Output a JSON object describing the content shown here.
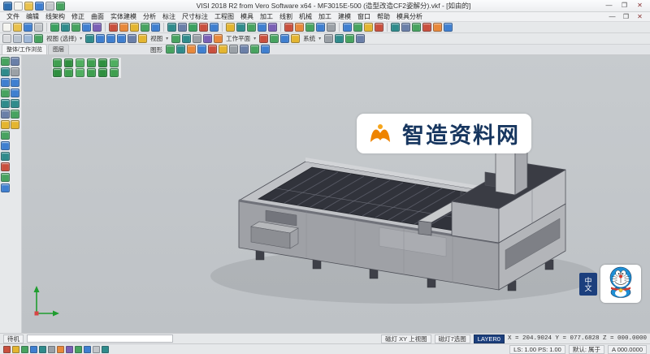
{
  "window": {
    "title": "VISI 2018 R2 from Vero Software x64  -  MF3015E-500 (造型改造CF2姿解分).vkf - [如由的]",
    "minimize": "—",
    "maximize": "❐",
    "close": "✕"
  },
  "qat": [
    {
      "n": "app-logo-icon",
      "c": "#2f6fb0"
    },
    {
      "n": "new-file-icon",
      "c": "#f4f4ef"
    },
    {
      "n": "open-folder-icon",
      "c": "#e9c14d"
    },
    {
      "n": "save-icon",
      "c": "#3f7fd0"
    },
    {
      "n": "print-icon",
      "c": "#c2c6ca"
    },
    {
      "n": "undo-icon",
      "c": "#47a35f"
    }
  ],
  "menu": {
    "items": [
      "文件",
      "编辑",
      "线架构",
      "修正",
      "曲面",
      "实体建模",
      "分析",
      "标注",
      "尺寸标注",
      "工程图",
      "模具",
      "加工",
      "线割",
      "机械",
      "加工",
      "建模",
      "窗口",
      "帮助",
      "模具分析"
    ]
  },
  "toolbars": {
    "row1": [
      {
        "n": "new-file-icon",
        "c": "#f4f4ef"
      },
      {
        "n": "open-folder-icon",
        "c": "#e9c14d"
      },
      {
        "n": "save-icon",
        "c": "#3f7fd0"
      },
      {
        "n": "print-icon",
        "c": "#c2c6ca"
      },
      "|",
      {
        "n": "point-tool-icon",
        "c": "#3aa15f"
      },
      {
        "n": "line-tool-icon",
        "c": "#2f8b8b"
      },
      {
        "n": "arc-tool-icon",
        "c": "#47a35f"
      },
      {
        "n": "circle-tool-icon",
        "c": "#3f7fd0"
      },
      {
        "n": "curve-tool-icon",
        "c": "#7a5fb5"
      },
      "|",
      {
        "n": "trim-tool-icon",
        "c": "#c94f3d"
      },
      {
        "n": "extend-tool-icon",
        "c": "#e8883a"
      },
      {
        "n": "fillet-tool-icon",
        "c": "#e4b52f"
      },
      {
        "n": "chamfer-tool-icon",
        "c": "#47a35f"
      },
      {
        "n": "offset-tool-icon",
        "c": "#3f7fd0"
      },
      "|",
      {
        "n": "surface-tool-icon",
        "c": "#2f8b8b"
      },
      {
        "n": "loft-tool-icon",
        "c": "#6a7fa8"
      },
      {
        "n": "sweep-tool-icon",
        "c": "#3aa15f"
      },
      {
        "n": "revolve-tool-icon",
        "c": "#c94f3d"
      },
      {
        "n": "extrude-tool-icon",
        "c": "#3f7fd0"
      },
      "|",
      {
        "n": "solid-box-icon",
        "c": "#e4b52f"
      },
      {
        "n": "solid-cylinder-icon",
        "c": "#2f8b8b"
      },
      {
        "n": "boolean-union-icon",
        "c": "#47a35f"
      },
      {
        "n": "boolean-subtract-icon",
        "c": "#3f7fd0"
      },
      {
        "n": "shell-tool-icon",
        "c": "#7a5fb5"
      },
      "|",
      {
        "n": "measure-icon",
        "c": "#c94f3d"
      },
      {
        "n": "dimension-icon",
        "c": "#e8883a"
      },
      {
        "n": "annotate-icon",
        "c": "#47a35f"
      },
      {
        "n": "layer-manager-icon",
        "c": "#3f7fd0"
      },
      {
        "n": "properties-icon",
        "c": "#9aa0a6"
      },
      "|",
      {
        "n": "analysis-icon",
        "c": "#3f7fd0"
      },
      {
        "n": "draft-check-icon",
        "c": "#47a35f"
      },
      {
        "n": "curvature-icon",
        "c": "#e4b52f"
      },
      {
        "n": "section-icon",
        "c": "#c94f3d"
      },
      "|",
      {
        "n": "machining-icon",
        "c": "#2f8b8b"
      },
      {
        "n": "toolpath-icon",
        "c": "#6a7fa8"
      },
      {
        "n": "simulate-icon",
        "c": "#47a35f"
      },
      {
        "n": "post-processor-icon",
        "c": "#c94f3d"
      },
      {
        "n": "report-icon",
        "c": "#e8883a"
      },
      {
        "n": "help-icon",
        "c": "#3f7fd0"
      }
    ],
    "row2": [
      {
        "n": "select-icon",
        "c": "#d8dadd"
      },
      {
        "n": "select-window-icon",
        "c": "#b9c3cf"
      },
      {
        "n": "select-polygon-icon",
        "c": "#9fb8d8"
      },
      {
        "n": "selection-filter-icon",
        "c": "#47a35f"
      },
      {
        "label": "视图 (选择)"
      },
      {
        "n": "view-iso-icon",
        "c": "#2f8b8b"
      },
      {
        "n": "view-top-icon",
        "c": "#3f7fd0"
      },
      {
        "n": "view-front-icon",
        "c": "#3f7fd0"
      },
      {
        "n": "view-right-icon",
        "c": "#3f7fd0"
      },
      {
        "n": "view-back-icon",
        "c": "#6a7fa8"
      },
      {
        "n": "zoom-all-icon",
        "c": "#e4b52f"
      },
      {
        "label": "视图"
      },
      {
        "n": "shaded-mode-icon",
        "c": "#47a35f"
      },
      {
        "n": "wireframe-mode-icon",
        "c": "#2f8b8b"
      },
      {
        "n": "hidden-line-icon",
        "c": "#9aa0a6"
      },
      {
        "n": "perspective-icon",
        "c": "#7a5fb5"
      },
      {
        "n": "light-icon",
        "c": "#e8883a"
      },
      {
        "label": "工作平面"
      },
      {
        "n": "workplane-xy-icon",
        "c": "#c94f3d"
      },
      {
        "n": "workplane-yz-icon",
        "c": "#47a35f"
      },
      {
        "n": "workplane-zx-icon",
        "c": "#3f7fd0"
      },
      {
        "n": "workplane-custom-icon",
        "c": "#e4b52f"
      },
      {
        "label": "系统"
      },
      {
        "n": "settings-icon",
        "c": "#9aa0a6"
      },
      {
        "n": "grid-icon",
        "c": "#2f8b8b"
      },
      {
        "n": "snap-icon",
        "c": "#47a35f"
      },
      {
        "n": "units-icon",
        "c": "#6a7fa8"
      }
    ],
    "row3": [
      {
        "n": "render-mode-icon",
        "c": "#47a35f"
      },
      {
        "n": "shadow-icon",
        "c": "#2f8b8b"
      },
      {
        "n": "material-icon",
        "c": "#e8883a"
      },
      {
        "n": "background-icon",
        "c": "#3f7fd0"
      },
      {
        "n": "clip-plane-icon",
        "c": "#c94f3d"
      },
      {
        "n": "explode-icon",
        "c": "#e4b52f"
      },
      {
        "n": "transparency-icon",
        "c": "#9aa0a6"
      },
      {
        "n": "edge-display-icon",
        "c": "#6a7fa8"
      },
      {
        "n": "axes-display-icon",
        "c": "#47a35f"
      },
      {
        "n": "refresh-view-icon",
        "c": "#3f7fd0"
      }
    ]
  },
  "left_panel": {
    "tabs": [
      "整体/工作浏览",
      "图层"
    ],
    "graphics_label": "图形",
    "strip_a": [
      {
        "n": "select-entity-icon",
        "c": "#47a35f"
      },
      {
        "n": "hide-entity-icon",
        "c": "#2f8b8b"
      },
      {
        "n": "show-all-icon",
        "c": "#3f7fd0"
      },
      {
        "n": "isolate-icon",
        "c": "#47a35f"
      },
      {
        "n": "group-icon",
        "c": "#2f8b8b"
      },
      {
        "n": "ungroup-icon",
        "c": "#6a7fa8"
      },
      {
        "n": "move-icon",
        "c": "#e4b52f"
      },
      {
        "n": "rotate-icon",
        "c": "#47a35f"
      },
      {
        "n": "mirror-icon",
        "c": "#3f7fd0"
      },
      {
        "n": "scale-icon",
        "c": "#2f8b8b"
      },
      {
        "n": "array-icon",
        "c": "#c94f3d"
      },
      {
        "n": "delete-icon",
        "c": "#47a35f"
      },
      {
        "n": "regen-icon",
        "c": "#3f7fd0"
      }
    ],
    "strip_b": [
      {
        "n": "view-rotate-icon",
        "c": "#6a7fa8"
      },
      {
        "n": "pan-icon",
        "c": "#9aa0a6"
      },
      {
        "n": "zoom-in-icon",
        "c": "#3f7fd0"
      },
      {
        "n": "zoom-out-icon",
        "c": "#3f7fd0"
      },
      {
        "n": "zoom-window-icon",
        "c": "#2f8b8b"
      },
      {
        "n": "previous-view-icon",
        "c": "#47a35f"
      },
      {
        "n": "named-views-icon",
        "c": "#e4b52f"
      }
    ],
    "quick_grid": [
      {
        "n": "quick-toggle-1-icon",
        "c": "#3f9f4f"
      },
      {
        "n": "quick-toggle-2-icon",
        "c": "#2f8f3f"
      },
      {
        "n": "quick-toggle-3-icon",
        "c": "#4fae5f"
      },
      {
        "n": "quick-toggle-4-icon",
        "c": "#3f9f4f"
      },
      {
        "n": "quick-toggle-5-icon",
        "c": "#2f8f3f"
      },
      {
        "n": "quick-toggle-6-icon",
        "c": "#4fae5f"
      },
      {
        "n": "quick-toggle-7-icon",
        "c": "#2f8f3f"
      },
      {
        "n": "quick-toggle-8-icon",
        "c": "#3f9f4f"
      },
      {
        "n": "quick-toggle-9-icon",
        "c": "#4fae5f"
      },
      {
        "n": "quick-toggle-10-icon",
        "c": "#3f9f4f"
      },
      {
        "n": "quick-toggle-11-icon",
        "c": "#2f8f3f"
      },
      {
        "n": "quick-toggle-12-icon",
        "c": "#3f9f4f"
      }
    ]
  },
  "viewport": {
    "watermark_text": "智造资料网",
    "sticker_label": "中文"
  },
  "status": {
    "mode": "待机",
    "view_button": "磁灯 XY 上视图",
    "snap_button": "磁灯7选图",
    "layer_button": "LAYER0",
    "coords": "X = 204.9024  Y = 077.6828  Z = 000.0000",
    "scale": "LS: 1.00  PS: 1.00",
    "defaults": "默认: 属于",
    "angle": "A 000.0000",
    "chips": [
      {
        "n": "snap-grid-toggle-icon",
        "c": "#c94f3d"
      },
      {
        "n": "snap-end-toggle-icon",
        "c": "#e4b52f"
      },
      {
        "n": "snap-mid-toggle-icon",
        "c": "#47a35f"
      },
      {
        "n": "snap-center-toggle-icon",
        "c": "#3f7fd0"
      },
      {
        "n": "snap-intersect-toggle-icon",
        "c": "#2f8b8b"
      },
      {
        "n": "ortho-toggle-icon",
        "c": "#9aa0a6"
      },
      {
        "n": "polar-toggle-icon",
        "c": "#e8883a"
      },
      {
        "n": "track-toggle-icon",
        "c": "#7a5fb5"
      },
      {
        "n": "dynamic-input-toggle-icon",
        "c": "#47a35f"
      },
      {
        "n": "lineweight-toggle-icon",
        "c": "#3f7fd0"
      },
      {
        "n": "transparency-toggle-icon",
        "c": "#c2c6ca"
      },
      {
        "n": "model-space-toggle-icon",
        "c": "#2f8b8b"
      }
    ]
  }
}
